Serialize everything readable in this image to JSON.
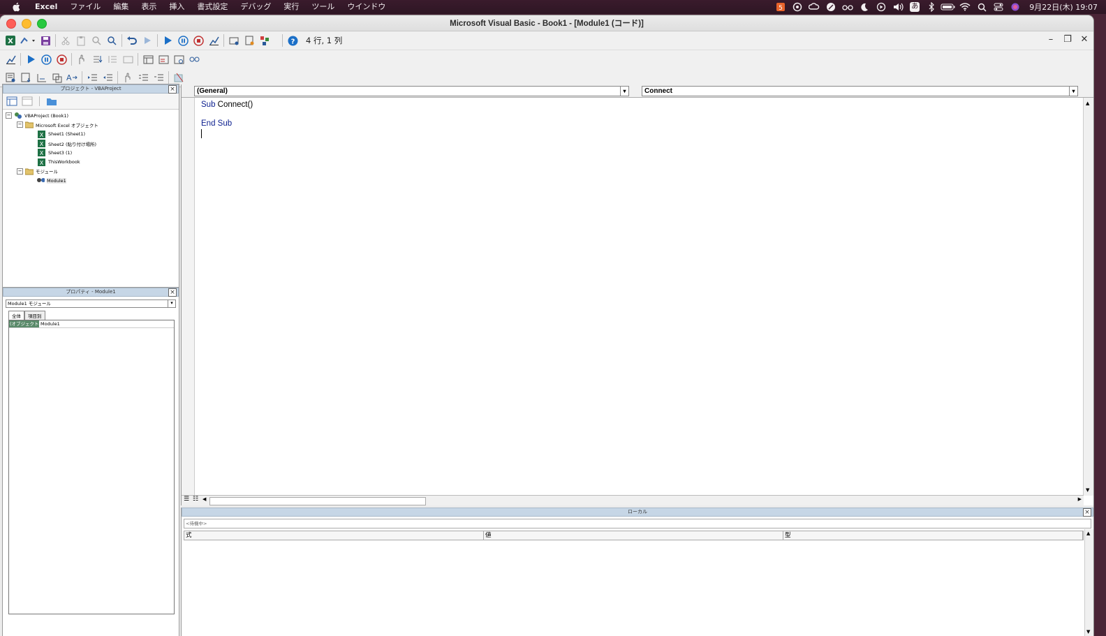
{
  "menubar": {
    "app": "Excel",
    "items": [
      "ファイル",
      "編集",
      "表示",
      "挿入",
      "書式設定",
      "デバッグ",
      "実行",
      "ツール",
      "ウインドウ"
    ],
    "input_mode": "あ",
    "clock": "9月22日(木)  19:07"
  },
  "window": {
    "title": "Microsoft Visual Basic - Book1 - [Module1 (コード)]",
    "position": "4 行, 1 列"
  },
  "project": {
    "header": "プロジェクト - VBAProject",
    "tree": [
      {
        "label": "VBAProject (Book1)"
      },
      {
        "label": "Microsoft Excel オブジェクト"
      },
      {
        "label": "Sheet1 (Sheet1)"
      },
      {
        "label": "Sheet2 (貼り付け場所)"
      },
      {
        "label": "Sheet3 (1)"
      },
      {
        "label": "ThisWorkbook"
      },
      {
        "label": "モジュール"
      },
      {
        "label": "Module1"
      }
    ]
  },
  "properties": {
    "header": "プロパティ - Module1",
    "object_selector": "Module1  モジュール",
    "tabs": [
      "全体",
      "項目別"
    ],
    "rows": [
      {
        "key": "(オブジェクト名)",
        "value": "Module1"
      }
    ]
  },
  "code": {
    "object_dropdown": "(General)",
    "procedure_dropdown": "Connect",
    "lines": {
      "sub_kw": "Sub",
      "sub_name": "Connect()",
      "end_kw": "End Sub"
    }
  },
  "locals": {
    "header": "ローカル",
    "status": "<待機中>",
    "columns": [
      "式",
      "値",
      "型"
    ]
  }
}
